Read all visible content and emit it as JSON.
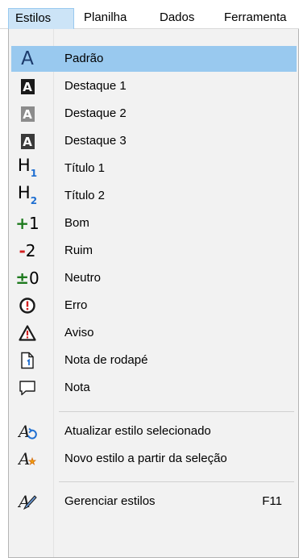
{
  "menubar": {
    "items": [
      "Estilos",
      "Planilha",
      "Dados",
      "Ferramenta"
    ]
  },
  "menu": {
    "items": [
      {
        "label": "Padrão"
      },
      {
        "label": "Destaque 1"
      },
      {
        "label": "Destaque 2"
      },
      {
        "label": "Destaque 3"
      },
      {
        "label": "Título 1"
      },
      {
        "label": "Título 2"
      },
      {
        "label": "Bom"
      },
      {
        "label": "Ruim"
      },
      {
        "label": "Neutro"
      },
      {
        "label": "Erro"
      },
      {
        "label": "Aviso"
      },
      {
        "label": "Nota de rodapé"
      },
      {
        "label": "Nota"
      },
      {
        "label": "Atualizar estilo selecionado"
      },
      {
        "label": "Novo estilo a partir da seleção"
      },
      {
        "label": "Gerenciar estilos",
        "shortcut": "F11"
      }
    ]
  },
  "icons": {
    "accent1_bg": "#1a1a1a",
    "accent2_bg": "#8c8c8c",
    "accent3_bg": "#3a3a3a",
    "good_color": "#1e7a1e",
    "bad_color": "#d42020",
    "neutral_sign_color": "#1e7a1e",
    "error_color": "#d42020",
    "warning_color": "#d42020",
    "heading_sub_color": "#1f6fd1",
    "h1_sub": "1",
    "h2_sub": "2",
    "good_text": "1",
    "bad_text": "2",
    "neutral_text": "0"
  },
  "colors": {
    "selection": "#99c9ef",
    "menu_bg": "#f2f2f2",
    "menubar_active": "#cce4f7"
  }
}
